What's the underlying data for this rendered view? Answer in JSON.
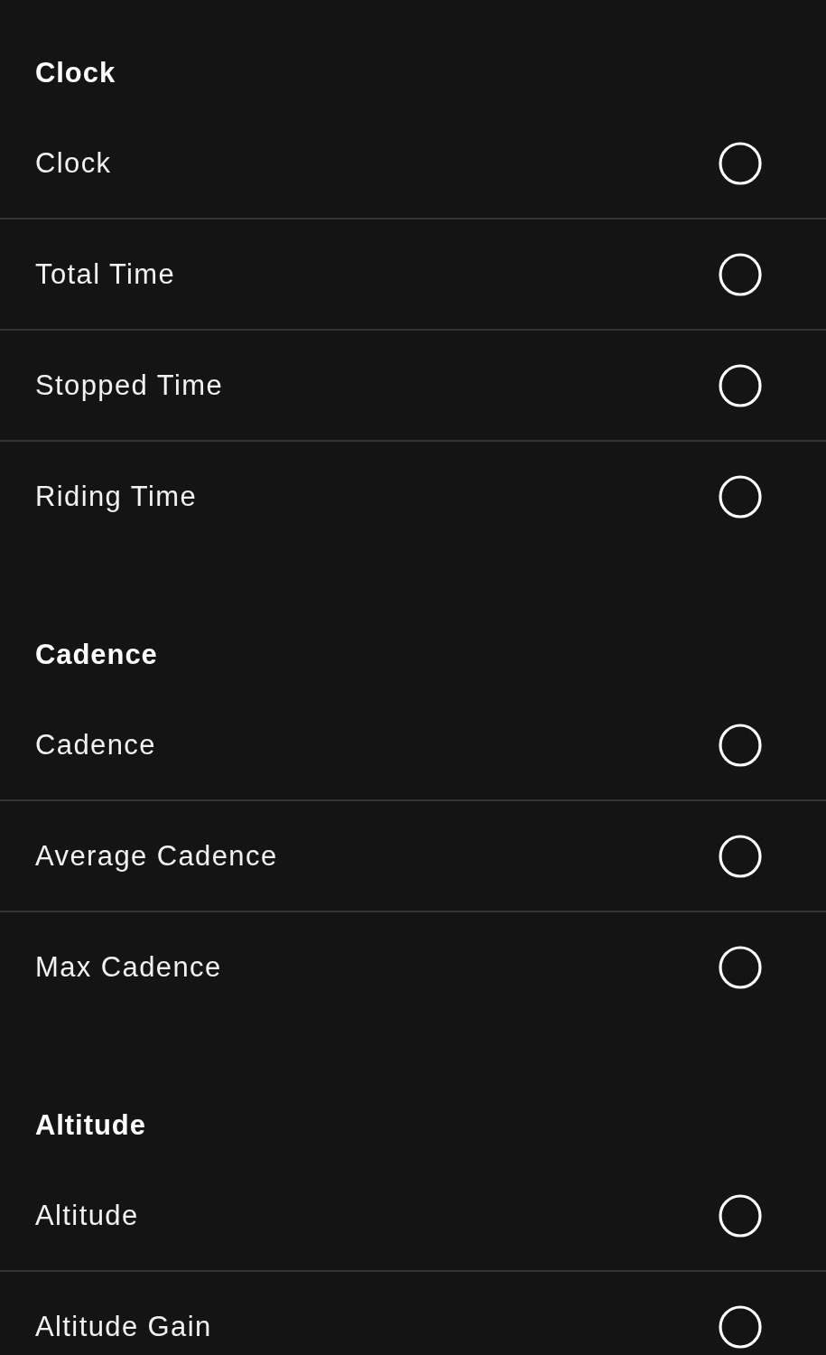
{
  "sections": [
    {
      "title": "Clock",
      "options": [
        {
          "label": "Clock",
          "selected": false
        },
        {
          "label": "Total Time",
          "selected": false
        },
        {
          "label": "Stopped Time",
          "selected": false
        },
        {
          "label": "Riding Time",
          "selected": false
        }
      ]
    },
    {
      "title": "Cadence",
      "options": [
        {
          "label": "Cadence",
          "selected": false
        },
        {
          "label": "Average Cadence",
          "selected": false
        },
        {
          "label": "Max Cadence",
          "selected": false
        }
      ]
    },
    {
      "title": "Altitude",
      "options": [
        {
          "label": "Altitude",
          "selected": false
        },
        {
          "label": "Altitude Gain",
          "selected": false
        }
      ]
    }
  ]
}
